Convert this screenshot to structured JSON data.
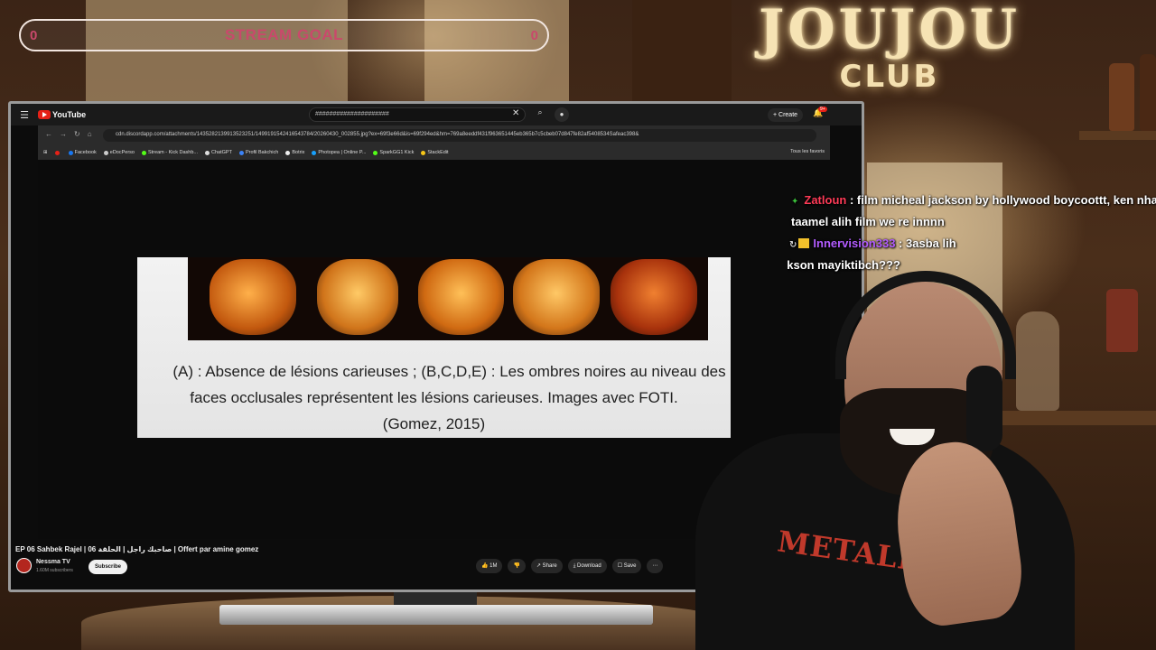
{
  "overlay": {
    "logo_main": "JOUJOU",
    "logo_sub": "CLUB",
    "stream_goal": {
      "label": "STREAM GOAL",
      "current": "0",
      "target": "0",
      "progress": 0.0
    }
  },
  "youtube": {
    "logo_text": "YouTube",
    "search_value": "#####################",
    "create_label": "+ Create",
    "notification_count": "9+",
    "video_title": "EP 06 Sahbek Rajel | صاحبك راجل | الحلقة 06 | Offert par amine gomez",
    "channel_name": "Nessma TV",
    "channel_subs": "1.60M subscribers",
    "subscribe_label": "Subscribe",
    "actions": {
      "like": "👍 1M",
      "dislike": "👎",
      "share": "↗ Share",
      "download": "⤓ Download",
      "save": "☐ Save",
      "more": "⋯"
    }
  },
  "browser": {
    "url": "cdn.discordapp.com/attachments/1435282139913523251/1499191542416543784/20260430_002855.jpg?ex=69f3e66d&is=69f294ed&hm=769a8eeddf431f963651445eb365b7c5cbeb07d847fe82af5408534Safeac398&",
    "bookmarks": [
      {
        "label": "",
        "color": "#e62117"
      },
      {
        "label": "Facebook",
        "color": "#1877f2"
      },
      {
        "label": "eDocPerso",
        "color": "#cccccc"
      },
      {
        "label": "Stream - Kick Dashb...",
        "color": "#53fc18"
      },
      {
        "label": "ChatGPT",
        "color": "#dddddd"
      },
      {
        "label": "Profil Bakchich",
        "color": "#3b82f6"
      },
      {
        "label": "Botrix",
        "color": "#eeeeee"
      },
      {
        "label": "Photopea | Online P...",
        "color": "#18a0fb"
      },
      {
        "label": "SparkGG1 Kick",
        "color": "#53fc18"
      },
      {
        "label": "StackEdit",
        "color": "#f5c518"
      }
    ],
    "all_bookmarks": "Tous les favoris"
  },
  "slide": {
    "caption_line1": "(A) : Absence de lésions carieuses ; (B,C,D,E) : Les ombres noires au niveau des",
    "caption_line2": "faces occlusales représentent les lésions carieuses. Images avec FOTI.",
    "caption_line3": "(Gomez, 2015)"
  },
  "chat": {
    "messages": [
      {
        "user": "Zatloun",
        "text": "film micheal jackson by hollywood boycoottt, ken nha"
      },
      {
        "user": "",
        "text": "taamel alih film we re innnn"
      },
      {
        "user": "Innervision333",
        "text": "3asba lih"
      },
      {
        "user": "",
        "text": "ckson mayiktibch???"
      }
    ]
  },
  "streamer": {
    "shirt_text": "METALLICA"
  },
  "colors": {
    "goal_accent": "#c9496b",
    "chat_user_red": "#ff3b57",
    "chat_user_purple": "#b35cff",
    "youtube_red": "#e62117"
  }
}
